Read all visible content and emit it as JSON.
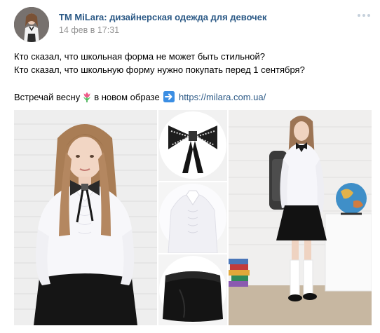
{
  "post": {
    "author": "TM MiLara: дизайнерская одежда для девочек",
    "date": "14 фев в 17:31",
    "text": {
      "line1": "Кто сказал, что школьная форма не может быть стильной?",
      "line2": "Кто сказал, что школьную форму нужно покупать перед 1 сентября?",
      "line3_before": "Встречай весну",
      "line3_middle": "в новом образе",
      "link": "https://milara.com.ua/"
    },
    "icons": {
      "more": "more-dots-icon",
      "tulip": "tulip-emoji-icon",
      "arrow": "right-arrow-emoji-icon"
    },
    "colors": {
      "author": "#2a5885",
      "date": "#939393",
      "link": "#2a5885",
      "more_dots": "#c5d0db"
    }
  }
}
